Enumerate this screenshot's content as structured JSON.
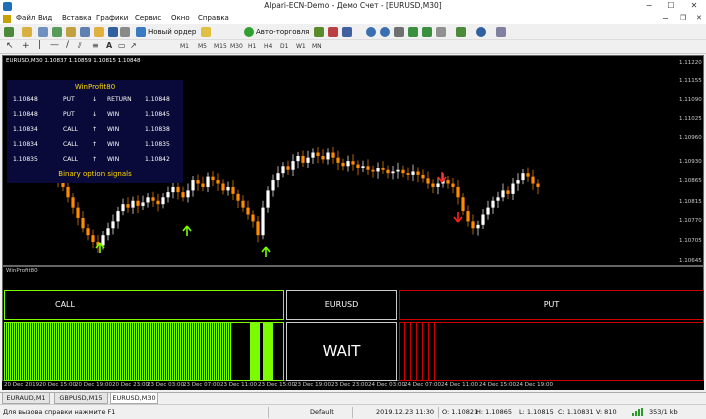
{
  "window": {
    "title": "Alpari-ECN-Demo - Демо Счет - [EURUSD,M30]"
  },
  "menu": [
    "Файл",
    "Вид",
    "Вставка",
    "Графики",
    "Сервис",
    "Окно",
    "Справка"
  ],
  "toolbar": {
    "new_order": "Новый ордер",
    "auto_trading": "Авто-торговля"
  },
  "timeframes": [
    "M1",
    "M5",
    "M15",
    "M30",
    "H1",
    "H4",
    "D1",
    "W1",
    "MN"
  ],
  "chart": {
    "header": "EURUSD,M30  1.10837 1.10859 1.10815 1.10848",
    "price_labels": [
      "1.11220",
      "1.11155",
      "1.11090",
      "1.11025",
      "1.10960",
      "1.10930",
      "1.10865",
      "1.10815",
      "1.10770",
      "1.10705",
      "1.10645"
    ]
  },
  "winprofit": {
    "title": "WinProfit80",
    "rows": [
      [
        "1.10848",
        "PUT",
        "↓",
        "RETURN",
        "1.10848"
      ],
      [
        "1.10848",
        "PUT",
        "↓",
        "WIN",
        "1.10845"
      ],
      [
        "1.10834",
        "CALL",
        "↑",
        "WIN",
        "1.10838"
      ],
      [
        "1.10834",
        "CALL",
        "↑",
        "WIN",
        "1.10835"
      ],
      [
        "1.10835",
        "CALL",
        "↑",
        "WIN",
        "1.10842"
      ]
    ],
    "footer": "Binary option signals"
  },
  "indicator": {
    "name": "WinProfit80",
    "call_label": "CALL",
    "symbol_label": "EURUSD",
    "put_label": "PUT",
    "status": "WAIT"
  },
  "xaxis": [
    "20 Dec 2019",
    "20 Dec 15:00",
    "20 Dec 19:00",
    "20 Dec 23:00",
    "23 Dec 03:00",
    "23 Dec 07:00",
    "23 Dec 11:00",
    "23 Dec 15:00",
    "23 Dec 19:00",
    "23 Dec 23:00",
    "24 Dec 03:00",
    "24 Dec 07:00",
    "24 Dec 11:00",
    "24 Dec 15:00",
    "24 Dec 19:00"
  ],
  "tabs": [
    "EURAUD,M1",
    "GBPUSD,M15",
    "EURUSD,M30"
  ],
  "status": {
    "help": "Для вызова справки нажмите F1",
    "profile": "Default",
    "datetime": "2019.12.23 11:30",
    "open": "O: 1.10821",
    "high": "H: 1.10865",
    "low": "L: 1.10815",
    "close": "C: 1.10831",
    "volume": "V: 810",
    "traffic": "353/1 kb"
  },
  "colors": {
    "bull": "#ffffff",
    "bear": "#ff8c00",
    "call_green": "#7cfc00",
    "put_red": "#cc0000",
    "panel_bg": "#0a0a3a",
    "panel_title": "#ffd700"
  }
}
